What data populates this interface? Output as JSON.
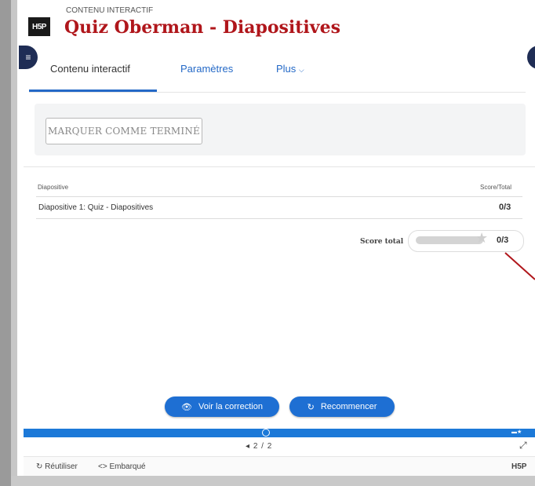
{
  "header": {
    "logo_text": "H5P",
    "content_type": "CONTENU INTERACTIF",
    "title": "Quiz Oberman - Diapositives"
  },
  "tabs": [
    {
      "label": "Contenu interactif",
      "active": true
    },
    {
      "label": "Paramètres",
      "active": false
    },
    {
      "label": "Plus",
      "active": false
    }
  ],
  "completion": {
    "mark_done_label": "MARQUER COMME TERMINÉ"
  },
  "summary": {
    "col_slide": "Diapositive",
    "col_score": "Score/Total",
    "rows": [
      {
        "label": "Diapositive 1: Quiz - Diapositives",
        "score": "0/3"
      }
    ],
    "total_label": "Score total",
    "total_score": "0/3",
    "total_progress": 0
  },
  "buttons": {
    "correction": "Voir la correction",
    "restart": "Recommencer"
  },
  "navigation": {
    "counter": "2 / 2"
  },
  "footer": {
    "reuse": "Réutiliser",
    "embed": "Embarqué",
    "brand": "H5P"
  },
  "colors": {
    "title": "#b0161b",
    "accent": "#1e6fd3",
    "tab_active_underline": "#2469c7"
  }
}
